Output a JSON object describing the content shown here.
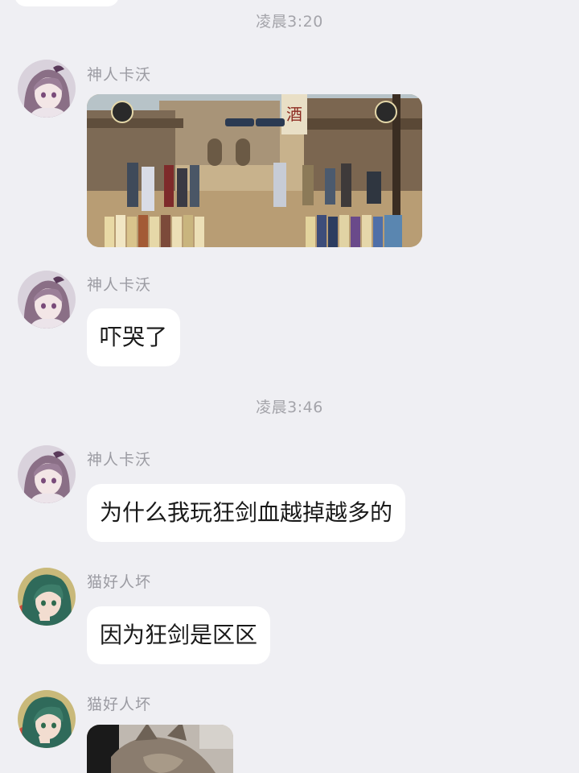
{
  "timestamps": [
    "凌晨3:20",
    "凌晨3:46"
  ],
  "messages": [
    {
      "sender": "神人卡沃",
      "type": "image",
      "avatar": "purple-hair-anime-avatar",
      "image_desc": "game-screenshot"
    },
    {
      "sender": "神人卡沃",
      "type": "text",
      "text": "吓哭了",
      "avatar": "purple-hair-anime-avatar"
    },
    {
      "sender": "神人卡沃",
      "type": "text",
      "text": "为什么我玩狂剑血越掉越多的",
      "avatar": "purple-hair-anime-avatar"
    },
    {
      "sender": "猫好人坏",
      "type": "text",
      "text": "因为狂剑是区区",
      "avatar": "green-hair-anime-avatar"
    },
    {
      "sender": "猫好人坏",
      "type": "image",
      "avatar": "green-hair-anime-avatar",
      "image_desc": "cat-photo"
    }
  ],
  "colors": {
    "background": "#efeff3",
    "bubble": "#ffffff",
    "sender_text": "#9b9ba2",
    "timestamp_text": "#a4a4aa",
    "message_text": "#1a1a1a"
  }
}
